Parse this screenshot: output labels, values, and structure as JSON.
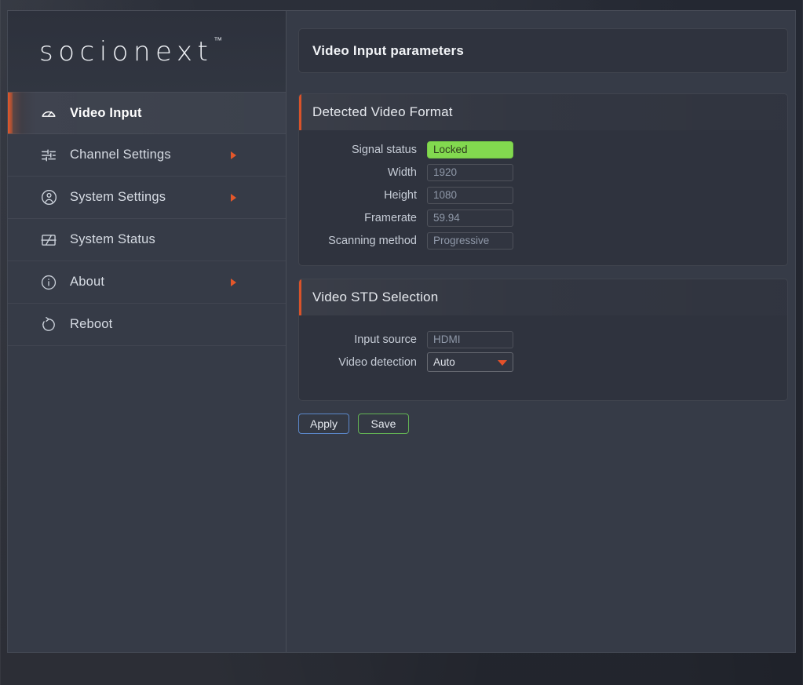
{
  "brand": {
    "name": "socionext",
    "tm": "™"
  },
  "sidebar": {
    "items": [
      {
        "label": "Video Input",
        "icon": "gauge-icon",
        "active": true,
        "arrow": false
      },
      {
        "label": "Channel Settings",
        "icon": "sliders-icon",
        "active": false,
        "arrow": true
      },
      {
        "label": "System Settings",
        "icon": "user-circle-icon",
        "active": false,
        "arrow": true
      },
      {
        "label": "System Status",
        "icon": "monitor-icon",
        "active": false,
        "arrow": false
      },
      {
        "label": "About",
        "icon": "info-circle-icon",
        "active": false,
        "arrow": true
      },
      {
        "label": "Reboot",
        "icon": "restart-icon",
        "active": false,
        "arrow": false
      }
    ]
  },
  "header": {
    "title": "Video Input parameters"
  },
  "panels": {
    "detected": {
      "title": "Detected Video Format",
      "fields": [
        {
          "label": "Signal status",
          "value": "Locked",
          "type": "status"
        },
        {
          "label": "Width",
          "value": "1920",
          "type": "readonly"
        },
        {
          "label": "Height",
          "value": "1080",
          "type": "readonly"
        },
        {
          "label": "Framerate",
          "value": "59.94",
          "type": "readonly"
        },
        {
          "label": "Scanning method",
          "value": "Progressive",
          "type": "readonly"
        }
      ]
    },
    "std": {
      "title": "Video STD Selection",
      "fields": [
        {
          "label": "Input source",
          "value": "HDMI",
          "type": "readonly"
        },
        {
          "label": "Video detection",
          "value": "Auto",
          "type": "select"
        }
      ]
    }
  },
  "buttons": {
    "apply": "Apply",
    "save": "Save"
  },
  "colors": {
    "accent_orange": "#e3592b",
    "status_green": "#82d94f",
    "apply_border": "#5b87c9",
    "save_border": "#63b354",
    "panel_bg": "#2f333e",
    "app_bg": "#363b47"
  }
}
